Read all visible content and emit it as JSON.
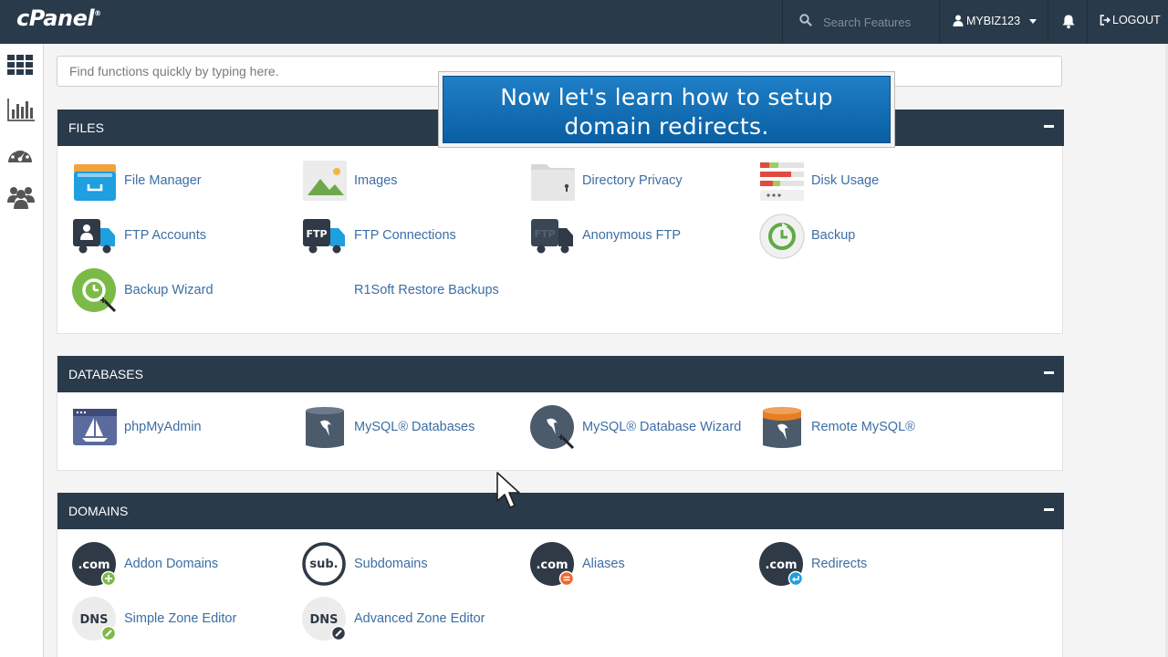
{
  "header": {
    "logo": "cPanel",
    "logo_mark": "®",
    "search_placeholder": "Search Features",
    "username": "MYBIZ123",
    "logout_label": "LOGOUT"
  },
  "sidebar": {
    "items": [
      {
        "name": "home",
        "icon": "grid-icon"
      },
      {
        "name": "stats",
        "icon": "bar-chart-icon"
      },
      {
        "name": "dashboard",
        "icon": "gauge-icon"
      },
      {
        "name": "users",
        "icon": "users-icon"
      }
    ]
  },
  "main": {
    "search_placeholder": "Find functions quickly by typing here."
  },
  "callout": {
    "line1": "Now let's learn how to setup",
    "line2": "domain redirects."
  },
  "sections": {
    "files": {
      "title": "FILES",
      "items": [
        {
          "label": "File Manager",
          "icon": "file-manager-icon"
        },
        {
          "label": "Images",
          "icon": "images-icon"
        },
        {
          "label": "Directory Privacy",
          "icon": "directory-privacy-icon"
        },
        {
          "label": "Disk Usage",
          "icon": "disk-usage-icon"
        },
        {
          "label": "FTP Accounts",
          "icon": "ftp-accounts-icon"
        },
        {
          "label": "FTP Connections",
          "icon": "ftp-connections-icon"
        },
        {
          "label": "Anonymous FTP",
          "icon": "anonymous-ftp-icon"
        },
        {
          "label": "Backup",
          "icon": "backup-icon"
        },
        {
          "label": "Backup Wizard",
          "icon": "backup-wizard-icon"
        },
        {
          "label": "R1Soft Restore Backups",
          "icon": ""
        }
      ]
    },
    "databases": {
      "title": "DATABASES",
      "items": [
        {
          "label": "phpMyAdmin",
          "icon": "phpmyadmin-icon"
        },
        {
          "label": "MySQL® Databases",
          "icon": "mysql-databases-icon"
        },
        {
          "label": "MySQL® Database Wizard",
          "icon": "mysql-wizard-icon"
        },
        {
          "label": "Remote MySQL®",
          "icon": "remote-mysql-icon"
        }
      ]
    },
    "domains": {
      "title": "DOMAINS",
      "items": [
        {
          "label": "Addon Domains",
          "icon": "addon-domains-icon",
          "text": ".com"
        },
        {
          "label": "Subdomains",
          "icon": "subdomains-icon",
          "text": "sub."
        },
        {
          "label": "Aliases",
          "icon": "aliases-icon",
          "text": ".com"
        },
        {
          "label": "Redirects",
          "icon": "redirects-icon",
          "text": ".com"
        },
        {
          "label": "Simple Zone Editor",
          "icon": "simple-zone-editor-icon",
          "text": "DNS"
        },
        {
          "label": "Advanced Zone Editor",
          "icon": "advanced-zone-editor-icon",
          "text": "DNS"
        }
      ]
    }
  },
  "colors": {
    "header_bg": "#293a4a",
    "link": "#3c6ea4",
    "callout_blue": "#0f6db8"
  }
}
